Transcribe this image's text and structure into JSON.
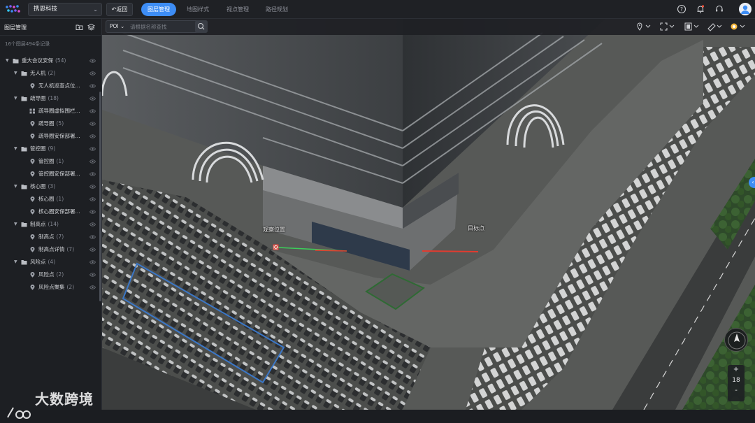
{
  "header": {
    "org_name": "携恩科技",
    "back_label": "返回",
    "tabs": [
      {
        "label": "图层管理",
        "active": true
      },
      {
        "label": "地图样式",
        "active": false
      },
      {
        "label": "视点管理",
        "active": false
      },
      {
        "label": "路径规划",
        "active": false
      }
    ],
    "icons": [
      "help-icon",
      "bell-icon",
      "headset-icon",
      "user-avatar"
    ]
  },
  "sidebar": {
    "title": "图层管理",
    "summary": "16个图层494条记录",
    "tree": [
      {
        "label": "重大会议安保",
        "count": "(54)",
        "level": 0,
        "type": "folder",
        "expanded": true
      },
      {
        "label": "无人机",
        "count": "(2)",
        "level": 1,
        "type": "folder",
        "expanded": true
      },
      {
        "label": "无人机巡查点位...",
        "count": "",
        "level": 2,
        "type": "point"
      },
      {
        "label": "疏导圈",
        "count": "(18)",
        "level": 1,
        "type": "folder",
        "expanded": true
      },
      {
        "label": "疏导圈虚拟围栏...",
        "count": "",
        "level": 2,
        "type": "grid"
      },
      {
        "label": "疏导圈",
        "count": "(5)",
        "level": 2,
        "type": "point"
      },
      {
        "label": "疏导圈安保部署...",
        "count": "",
        "level": 2,
        "type": "point"
      },
      {
        "label": "管控圈",
        "count": "(9)",
        "level": 1,
        "type": "folder",
        "expanded": true
      },
      {
        "label": "管控圈",
        "count": "(1)",
        "level": 2,
        "type": "point"
      },
      {
        "label": "管控圈安保部署...",
        "count": "",
        "level": 2,
        "type": "point"
      },
      {
        "label": "核心圈",
        "count": "(3)",
        "level": 1,
        "type": "folder",
        "expanded": true
      },
      {
        "label": "核心圈",
        "count": "(1)",
        "level": 2,
        "type": "point"
      },
      {
        "label": "核心圈安保部署...",
        "count": "",
        "level": 2,
        "type": "point"
      },
      {
        "label": "制高点",
        "count": "(14)",
        "level": 1,
        "type": "folder",
        "expanded": true
      },
      {
        "label": "制高点",
        "count": "(7)",
        "level": 2,
        "type": "point"
      },
      {
        "label": "制高点详情",
        "count": "(7)",
        "level": 2,
        "type": "point"
      },
      {
        "label": "风险点",
        "count": "(4)",
        "level": 1,
        "type": "folder",
        "expanded": true
      },
      {
        "label": "风险点",
        "count": "(2)",
        "level": 2,
        "type": "point"
      },
      {
        "label": "风险点聚集",
        "count": "(2)",
        "level": 2,
        "type": "point"
      }
    ]
  },
  "map": {
    "poi_label": "POI",
    "search_placeholder": "请根据名称查找",
    "labels": {
      "observer": "观察位置",
      "target": "目标点"
    },
    "zoom_in": "+",
    "zoom_level": "18",
    "zoom_out": "-",
    "accent_color": "#3d8df5"
  },
  "watermark": {
    "text": "大数跨境"
  }
}
